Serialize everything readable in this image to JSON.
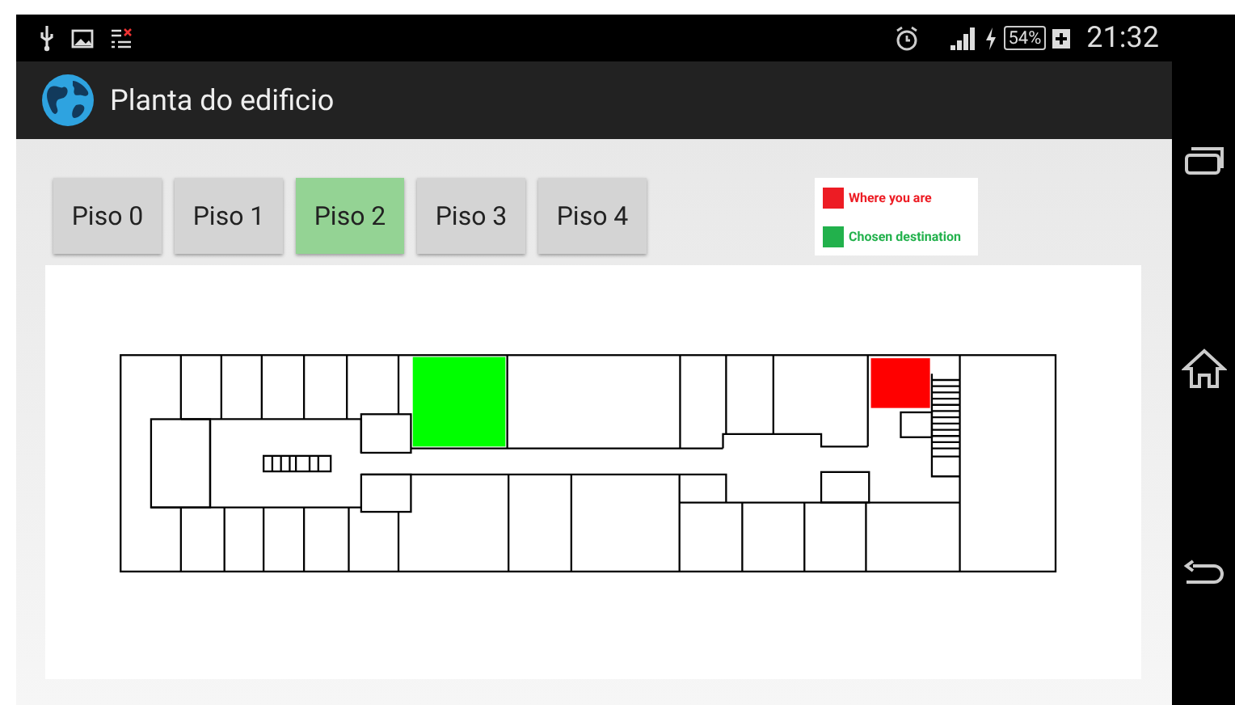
{
  "status_bar": {
    "battery": "54%",
    "time": "21:32"
  },
  "action_bar": {
    "title": "Planta do edificio"
  },
  "floors": [
    {
      "label": "Piso 0",
      "selected": false
    },
    {
      "label": "Piso 1",
      "selected": false
    },
    {
      "label": "Piso 2",
      "selected": true
    },
    {
      "label": "Piso 3",
      "selected": false
    },
    {
      "label": "Piso 4",
      "selected": false
    }
  ],
  "legend": [
    {
      "label": "Where you are",
      "color": "#ed1c24"
    },
    {
      "label": "Chosen destination",
      "color": "#22b14c"
    }
  ]
}
